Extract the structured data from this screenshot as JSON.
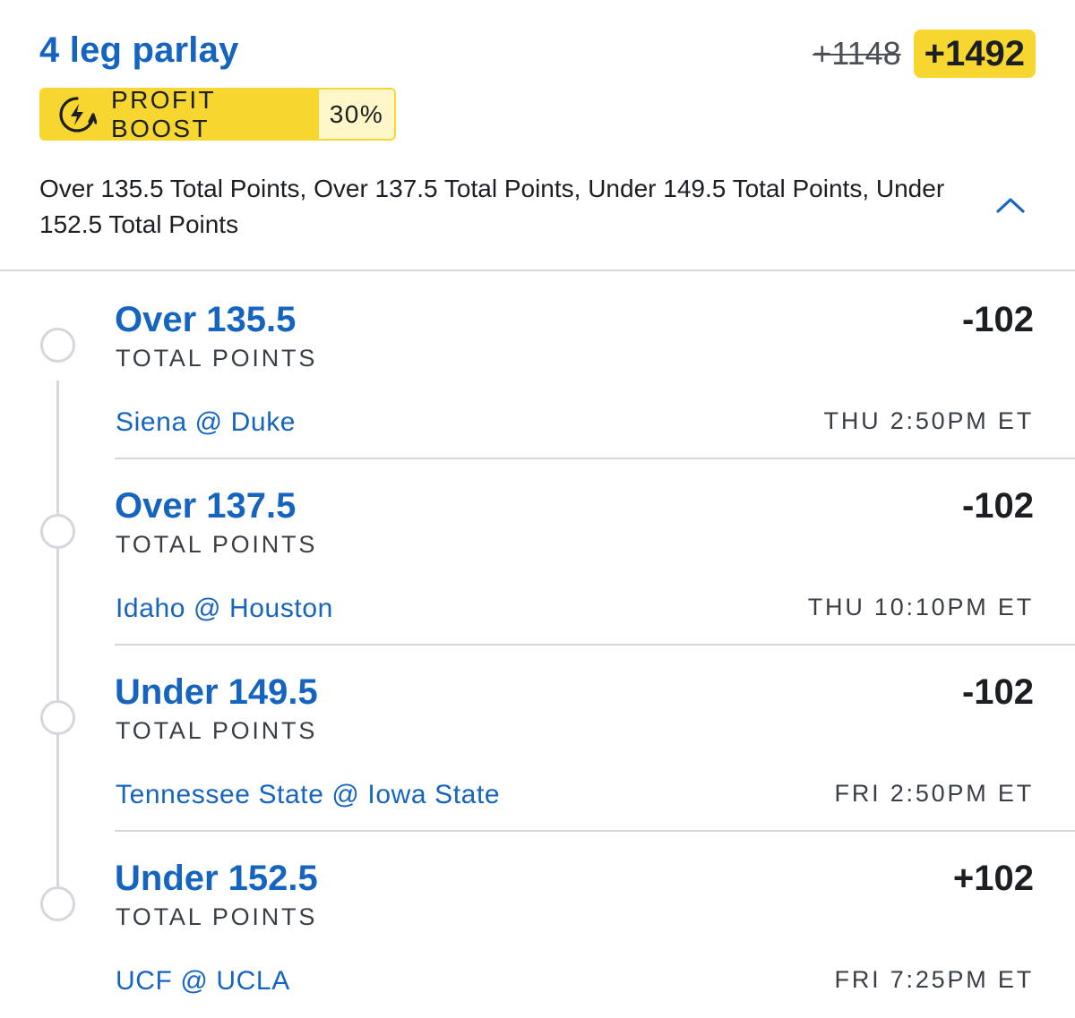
{
  "header": {
    "title": "4 leg parlay",
    "original_odds": "+1148",
    "boosted_odds": "+1492",
    "boost": {
      "label": "PROFIT BOOST",
      "percent": "30%",
      "icon": "lightning-bolt-icon"
    },
    "summary": "Over 135.5 Total Points, Over 137.5 Total Points, Under 149.5 Total Points, Under 152.5 Total Points",
    "collapse_icon": "chevron-up-icon"
  },
  "legs": [
    {
      "pick": "Over 135.5",
      "market": "TOTAL POINTS",
      "odds": "-102",
      "matchup": "Siena @ Duke",
      "time": "THU 2:50PM ET"
    },
    {
      "pick": "Over 137.5",
      "market": "TOTAL POINTS",
      "odds": "-102",
      "matchup": "Idaho @ Houston",
      "time": "THU 10:10PM ET"
    },
    {
      "pick": "Under 149.5",
      "market": "TOTAL POINTS",
      "odds": "-102",
      "matchup": "Tennessee State @ Iowa State",
      "time": "FRI 2:50PM ET"
    },
    {
      "pick": "Under 152.5",
      "market": "TOTAL POINTS",
      "odds": "+102",
      "matchup": "UCF @ UCLA",
      "time": "FRI 7:25PM ET"
    }
  ],
  "colors": {
    "accent_blue": "#1565c0",
    "boost_yellow": "#f7d62f",
    "boost_light": "#fff7c9",
    "divider": "#d4d7dd",
    "text_dark": "#1b1e23"
  }
}
